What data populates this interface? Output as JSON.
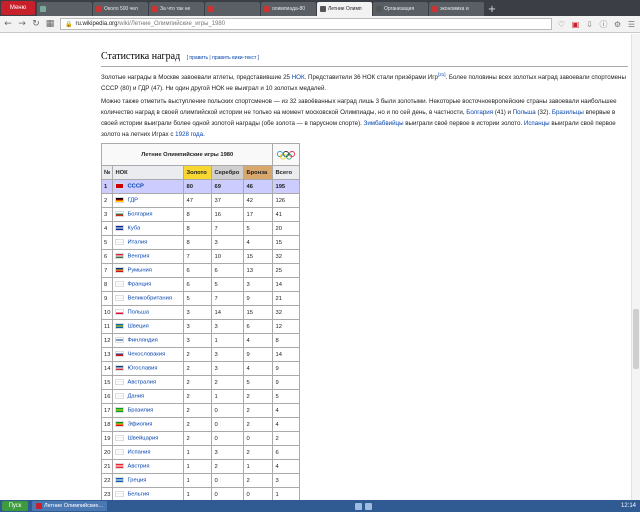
{
  "browser": {
    "menu_label": "Меню",
    "tabs": [
      {
        "label": "",
        "color": "#7a9"
      },
      {
        "label": "Около 500 чел",
        "color": "#c33"
      },
      {
        "label": "За что так не",
        "color": "#c33"
      },
      {
        "label": "",
        "color": "#c33"
      },
      {
        "label": "олимпиада-80",
        "color": "#c33"
      },
      {
        "label": "Летние Олимп",
        "color": "#555",
        "active": true
      },
      {
        "label": "Организация",
        "color": "#555"
      },
      {
        "label": "экономика и",
        "color": "#c33"
      }
    ],
    "url_domain": "ru.wikipedia.org",
    "url_path": "/wiki/Летние_Олимпийские_игры_1980"
  },
  "article": {
    "heading": "Статистика наград",
    "edit_links": "[ править | править вики-текст ]",
    "para1_parts": [
      "Золотые награды в Москве завоевали атлеты, представившие 25 ",
      "НОК",
      ". Представители 36 НОК стали призёрами Игр",
      "[21]",
      ". Более половины всех золотых наград завоевали спортсмены СССР (80) и ГДР (47). Ни один другой НОК не выиграл и 10 золотых медалей."
    ],
    "para2_parts": [
      "Можно также отметить выступление польских спортсменов — из 32 завоёванных наград лишь 3 были золотыми. Некоторые восточноевропейские страны завоевали наибольшее количество наград в своей олимпийской истории не только на момент московской Олимпиады, но и по сей день, в частности, ",
      "Болгария",
      " (41) и ",
      "Польша",
      " (32). ",
      "Бразильцы",
      " впервые в своей истории выиграли более одной золотой награды (обе золота — в парусном спорте). ",
      "Зимбабвийцы",
      " выиграли своё первое в истории золото. ",
      "Испанцы",
      " выиграли своё первое золото на летних Играх с ",
      "1928 года",
      "."
    ]
  },
  "medal_table": {
    "caption": "Летние Олимпийские игры 1980",
    "headers": {
      "rank": "№",
      "noc": "НОК",
      "gold": "Золото",
      "silver": "Серебро",
      "bronze": "Бронза",
      "total": "Всего"
    },
    "rows": [
      {
        "rank": "1",
        "country": "СССР",
        "gold": "80",
        "silver": "69",
        "bronze": "46",
        "total": "195",
        "flag": [
          "#cc0000",
          "#cc0000",
          "#cc0000"
        ]
      },
      {
        "rank": "2",
        "country": "ГДР",
        "gold": "47",
        "silver": "37",
        "bronze": "42",
        "total": "126",
        "flag": [
          "#000000",
          "#dd0000",
          "#ffce00"
        ]
      },
      {
        "rank": "3",
        "country": "Болгария",
        "gold": "8",
        "silver": "16",
        "bronze": "17",
        "total": "41",
        "flag": [
          "#ffffff",
          "#00966e",
          "#d62612"
        ]
      },
      {
        "rank": "4",
        "country": "Куба",
        "gold": "8",
        "silver": "7",
        "bronze": "5",
        "total": "20",
        "flag": [
          "#002a8f",
          "#ffffff",
          "#002a8f"
        ]
      },
      {
        "rank": "5",
        "country": "Италия",
        "gold": "8",
        "silver": "3",
        "bronze": "4",
        "total": "15",
        "flag": [
          "#ffffff",
          "#e8e8e8",
          "#ffffff"
        ]
      },
      {
        "rank": "6",
        "country": "Венгрия",
        "gold": "7",
        "silver": "10",
        "bronze": "15",
        "total": "32",
        "flag": [
          "#ce2939",
          "#ffffff",
          "#477050"
        ]
      },
      {
        "rank": "7",
        "country": "Румыния",
        "gold": "6",
        "silver": "6",
        "bronze": "13",
        "total": "25",
        "flag": [
          "#002b7f",
          "#fcd116",
          "#ce1126"
        ]
      },
      {
        "rank": "8",
        "country": "Франция",
        "gold": "6",
        "silver": "5",
        "bronze": "3",
        "total": "14",
        "flag": [
          "#ffffff",
          "#e8e8e8",
          "#ffffff"
        ]
      },
      {
        "rank": "9",
        "country": "Великобритания",
        "gold": "5",
        "silver": "7",
        "bronze": "9",
        "total": "21",
        "flag": [
          "#ffffff",
          "#e8e8e8",
          "#ffffff"
        ]
      },
      {
        "rank": "10",
        "country": "Польша",
        "gold": "3",
        "silver": "14",
        "bronze": "15",
        "total": "32",
        "flag": [
          "#ffffff",
          "#ffffff",
          "#dc143c"
        ]
      },
      {
        "rank": "11",
        "country": "Швеция",
        "gold": "3",
        "silver": "3",
        "bronze": "6",
        "total": "12",
        "flag": [
          "#006aa7",
          "#fecc00",
          "#006aa7"
        ]
      },
      {
        "rank": "12",
        "country": "Финляндия",
        "gold": "3",
        "silver": "1",
        "bronze": "4",
        "total": "8",
        "flag": [
          "#ffffff",
          "#003580",
          "#ffffff"
        ]
      },
      {
        "rank": "13",
        "country": "Чехословакия",
        "gold": "2",
        "silver": "3",
        "bronze": "9",
        "total": "14",
        "flag": [
          "#ffffff",
          "#11457e",
          "#d7141a"
        ]
      },
      {
        "rank": "14",
        "country": "Югославия",
        "gold": "2",
        "silver": "3",
        "bronze": "4",
        "total": "9",
        "flag": [
          "#0c4076",
          "#ffffff",
          "#c6363c"
        ]
      },
      {
        "rank": "15",
        "country": "Австралия",
        "gold": "2",
        "silver": "2",
        "bronze": "5",
        "total": "9",
        "flag": [
          "#ffffff",
          "#e8e8e8",
          "#ffffff"
        ]
      },
      {
        "rank": "16",
        "country": "Дания",
        "gold": "2",
        "silver": "1",
        "bronze": "2",
        "total": "5",
        "flag": [
          "#ffffff",
          "#e8e8e8",
          "#ffffff"
        ]
      },
      {
        "rank": "17",
        "country": "Бразилия",
        "gold": "2",
        "silver": "0",
        "bronze": "2",
        "total": "4",
        "flag": [
          "#009c3b",
          "#ffdf00",
          "#009c3b"
        ]
      },
      {
        "rank": "18",
        "country": "Эфиопия",
        "gold": "2",
        "silver": "0",
        "bronze": "2",
        "total": "4",
        "flag": [
          "#078930",
          "#fcdd09",
          "#da121a"
        ]
      },
      {
        "rank": "19",
        "country": "Швейцария",
        "gold": "2",
        "silver": "0",
        "bronze": "0",
        "total": "2",
        "flag": [
          "#ffffff",
          "#e8e8e8",
          "#ffffff"
        ]
      },
      {
        "rank": "20",
        "country": "Испания",
        "gold": "1",
        "silver": "3",
        "bronze": "2",
        "total": "6",
        "flag": [
          "#ffffff",
          "#e8e8e8",
          "#ffffff"
        ]
      },
      {
        "rank": "21",
        "country": "Австрия",
        "gold": "1",
        "silver": "2",
        "bronze": "1",
        "total": "4",
        "flag": [
          "#ed2939",
          "#ffffff",
          "#ed2939"
        ]
      },
      {
        "rank": "22",
        "country": "Греция",
        "gold": "1",
        "silver": "0",
        "bronze": "2",
        "total": "3",
        "flag": [
          "#0d5eaf",
          "#ffffff",
          "#0d5eaf"
        ]
      },
      {
        "rank": "23",
        "country": "Бельгия",
        "gold": "1",
        "silver": "0",
        "bronze": "0",
        "total": "1",
        "flag": [
          "#ffffff",
          "#e8e8e8",
          "#ffffff"
        ]
      }
    ]
  },
  "taskbar": {
    "start_label": "Пуск",
    "window_label": "Летние Олимпийские...",
    "clock": "12:14"
  }
}
